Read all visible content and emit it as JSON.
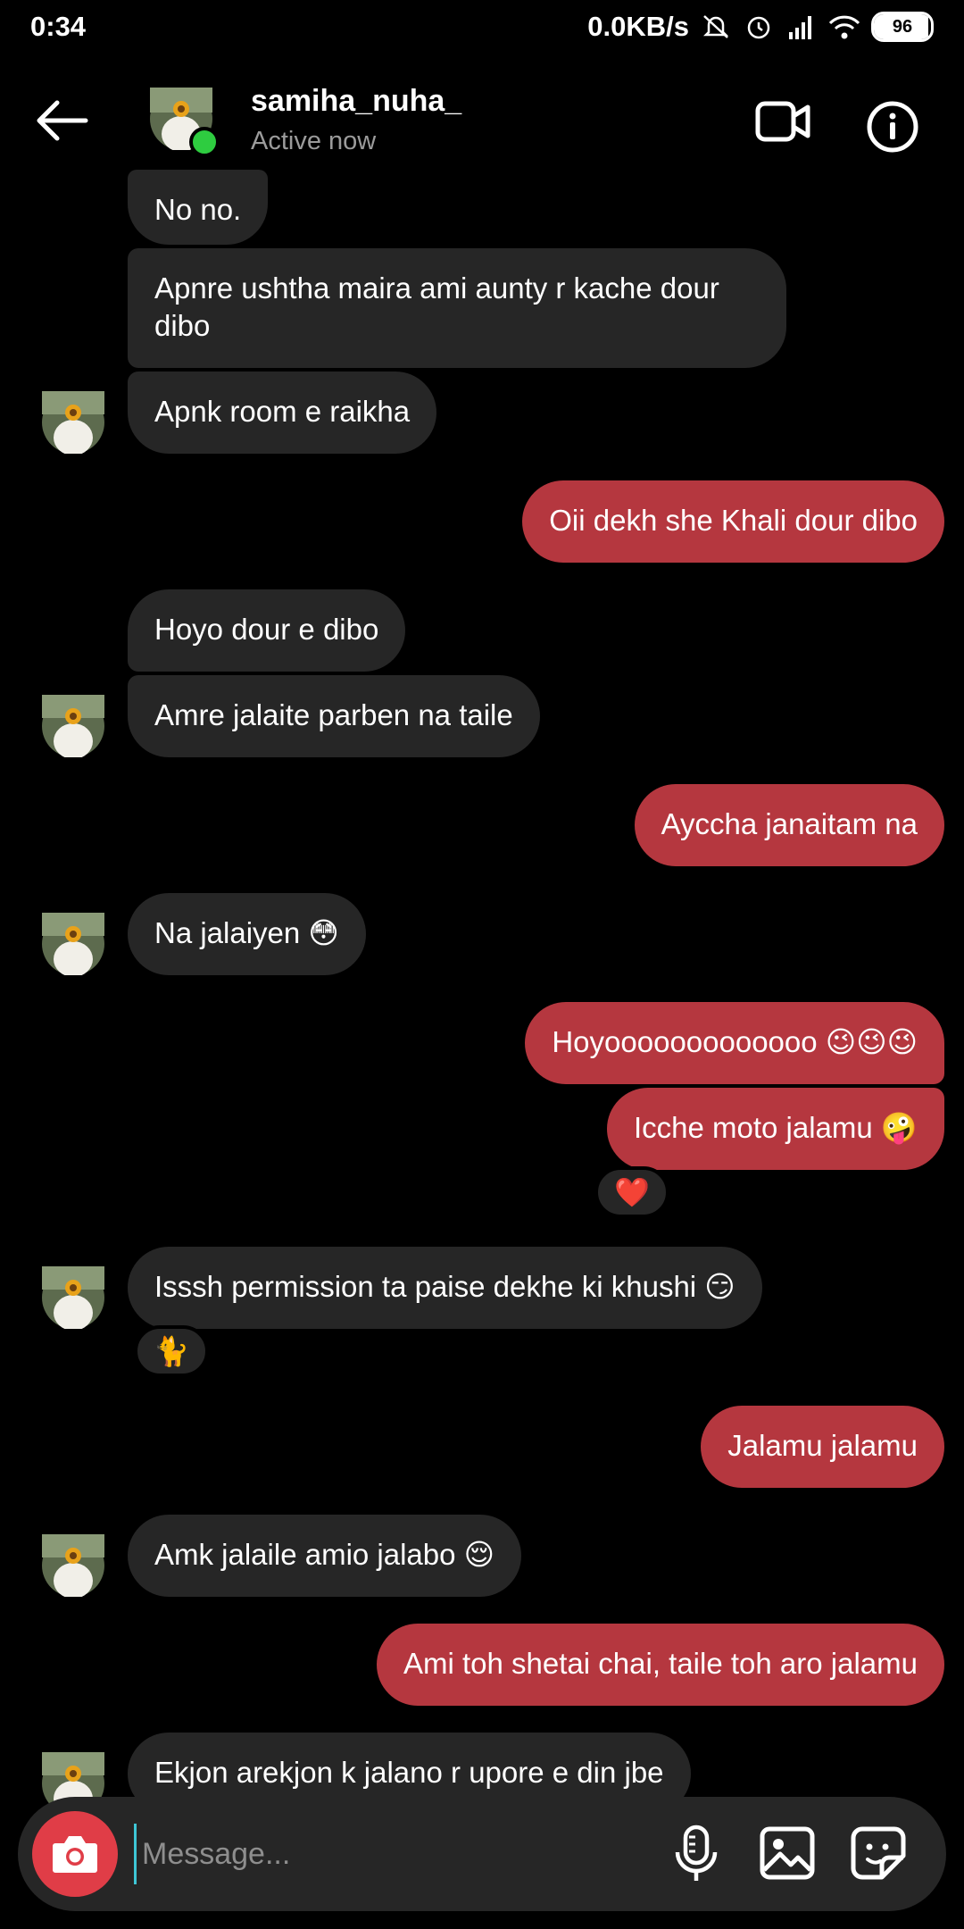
{
  "status_bar": {
    "time": "0:34",
    "network_speed": "0.0KB/s",
    "battery": "96",
    "icons": [
      "mute-icon",
      "alarm-icon",
      "signal-icon",
      "wifi-icon",
      "battery-icon"
    ]
  },
  "header": {
    "username": "samiha_nuha_",
    "status": "Active now",
    "icons": [
      "back-arrow-icon",
      "video-call-icon",
      "info-icon"
    ]
  },
  "messages": [
    {
      "dir": "in",
      "text": "No no."
    },
    {
      "dir": "in",
      "text": "Apnre ushtha maira ami aunty r kache dour dibo"
    },
    {
      "dir": "in",
      "text": "Apnk room e raikha"
    },
    {
      "dir": "out",
      "text": "Oii dekh she Khali dour dibo"
    },
    {
      "dir": "in",
      "text": "Hoyo dour e dibo"
    },
    {
      "dir": "in",
      "text": "Amre jalaite parben na taile"
    },
    {
      "dir": "out",
      "text": "Ayccha janaitam na"
    },
    {
      "dir": "in",
      "text": "Na jalaiyen 😳"
    },
    {
      "dir": "out",
      "text": "Hoyooooooooooooo 😉😉😉"
    },
    {
      "dir": "out",
      "text": "Icche moto jalamu 🤪",
      "reaction": "❤️"
    },
    {
      "dir": "in",
      "text": "Isssh permission ta paise dekhe ki khushi 😏",
      "reaction": "🐈"
    },
    {
      "dir": "out",
      "text": "Jalamu jalamu"
    },
    {
      "dir": "in",
      "text": "Amk jalaile amio jalabo 😌"
    },
    {
      "dir": "out",
      "text": "Ami toh shetai chai, taile toh aro jalamu"
    },
    {
      "dir": "in",
      "text": "Ekjon arekjon k jalano r upore e din jbe"
    }
  ],
  "composer": {
    "placeholder": "Message...",
    "icons": [
      "camera-icon",
      "microphone-icon",
      "gallery-icon",
      "sticker-icon"
    ]
  },
  "colors": {
    "background": "#000000",
    "incoming_bubble": "#262626",
    "outgoing_bubble": "#b5373f",
    "camera_button": "#e03d47",
    "online": "#2ecc40"
  }
}
